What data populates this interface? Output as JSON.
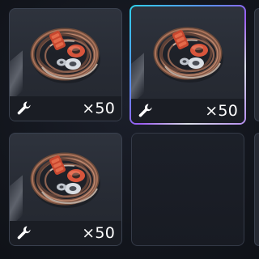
{
  "inventory": {
    "slots": [
      {
        "item_icon": "copper-wire-coil-icon",
        "type_icon": "wrench-icon",
        "quantity": "×50",
        "selected": false
      },
      {
        "item_icon": "copper-wire-coil-icon",
        "type_icon": "wrench-icon",
        "quantity": "×50",
        "selected": true
      },
      {
        "item_icon": "copper-wire-coil-icon",
        "type_icon": "wrench-icon",
        "quantity": "×50",
        "selected": false
      },
      {
        "empty": true
      }
    ]
  },
  "colors": {
    "background": "#14171f",
    "slot_fill": "#2a2e37",
    "slot_border": "#3a414f",
    "selected_gradient": [
      "#2fd0e8",
      "#5c8cf2",
      "#9b5cf0",
      "#d9dde6"
    ],
    "quantity_text": "#ffffff"
  }
}
